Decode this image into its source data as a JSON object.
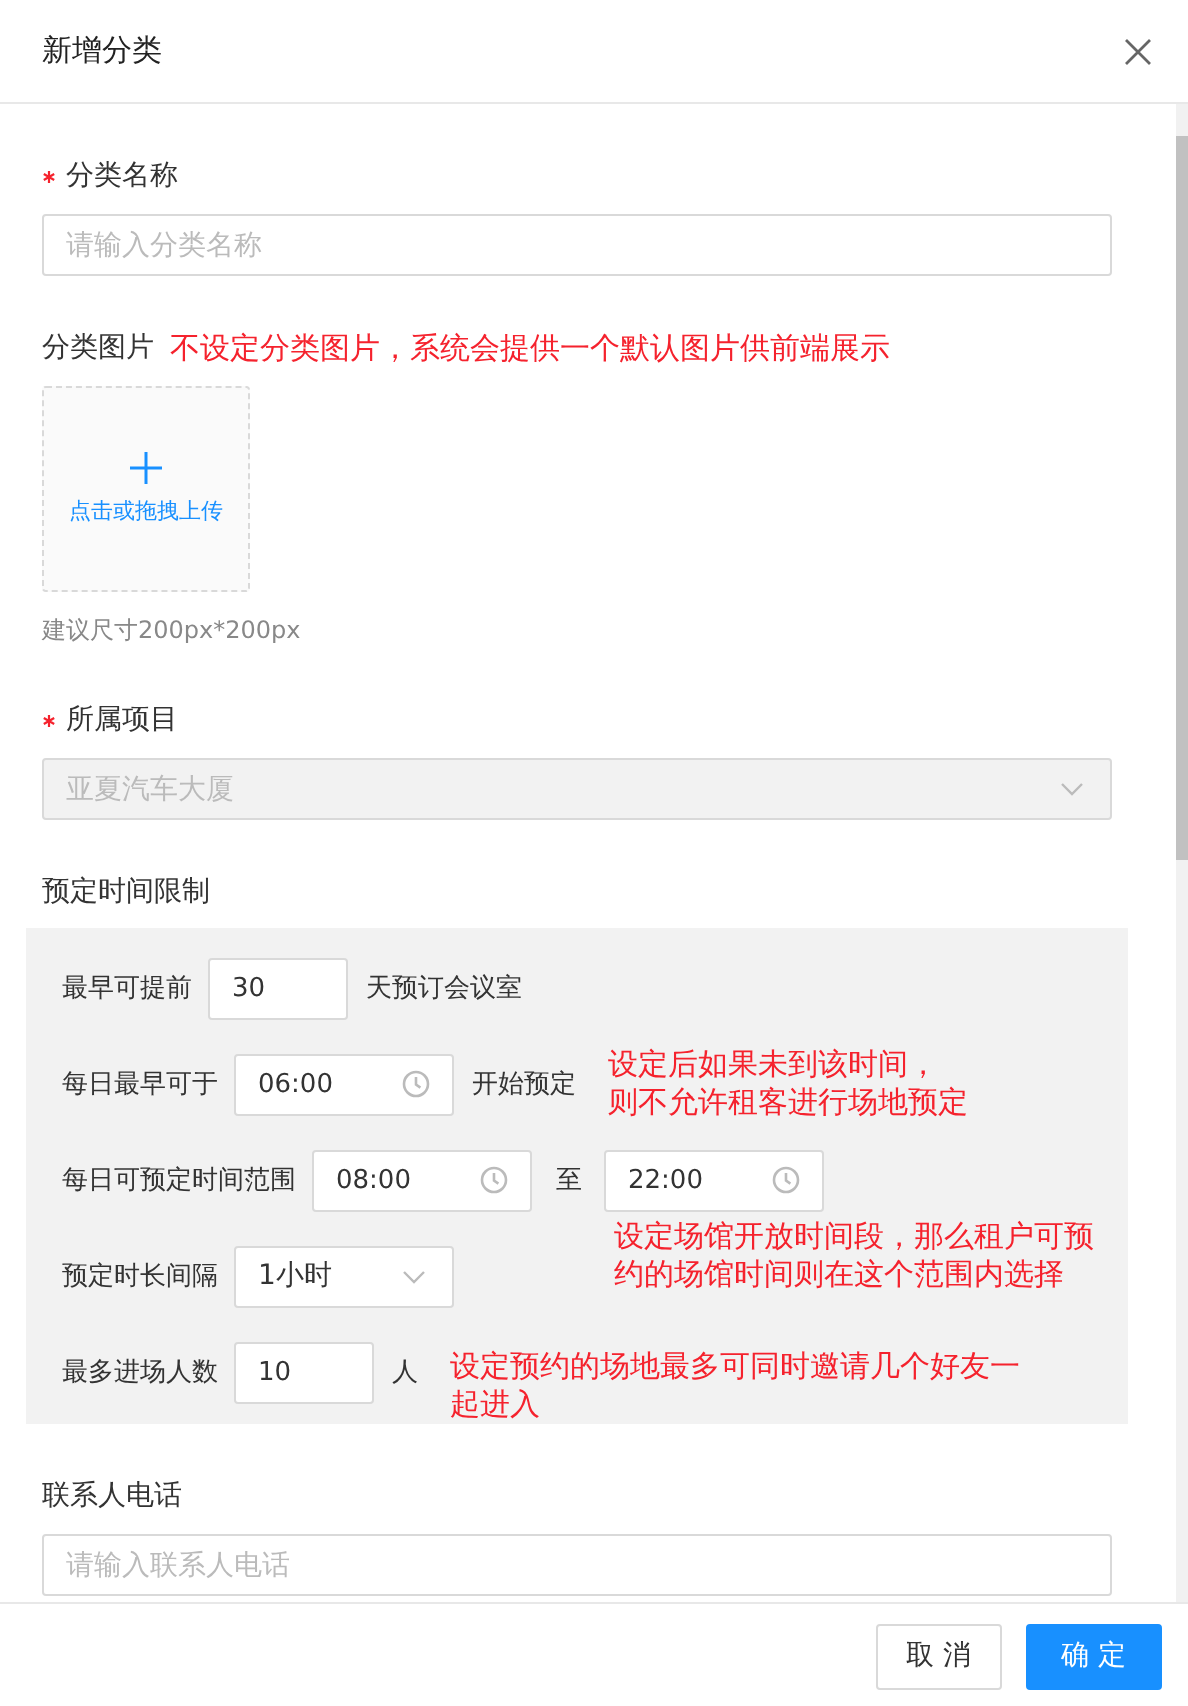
{
  "dialog": {
    "title": "新增分类"
  },
  "name_field": {
    "label": "分类名称",
    "required": true,
    "placeholder": "请输入分类名称"
  },
  "image_field": {
    "label": "分类图片",
    "annotation": "不设定分类图片，系统会提供一个默认图片供前端展示",
    "upload_text": "点击或拖拽上传",
    "hint": "建议尺寸200px*200px"
  },
  "project_field": {
    "label": "所属项目",
    "required": true,
    "value": "亚夏汽车大厦",
    "disabled": true
  },
  "time_limits": {
    "label": "预定时间限制",
    "rows": [
      {
        "kind": "number",
        "label": "最早可提前",
        "value": "30",
        "suffix": "天预订会议室"
      },
      {
        "kind": "time",
        "label": "每日最早可于",
        "value": "06:00",
        "suffix": "开始预定",
        "annotation": [
          "设定后如果未到该时间，",
          "则不允许租客进行场地预定"
        ]
      },
      {
        "kind": "range",
        "label": "每日可预定时间范围",
        "start": "08:00",
        "separator": "至",
        "end": "22:00"
      },
      {
        "kind": "select",
        "label": "预定时长间隔",
        "value": "1小时",
        "annotation": [
          "设定场馆开放时间段，那么租户可预",
          "约的场馆时间则在这个范围内选择"
        ]
      },
      {
        "kind": "number",
        "label": "最多进场人数",
        "value": "10",
        "suffix": "人",
        "annotation": [
          "设定预约的场地最多可同时邀请几个好友一",
          "起进入"
        ]
      }
    ]
  },
  "contact_field": {
    "label": "联系人电话",
    "placeholder": "请输入联系人电话"
  },
  "buttons": [
    {
      "label": "取 消",
      "primary": false
    },
    {
      "label": "确 定",
      "primary": true
    }
  ]
}
